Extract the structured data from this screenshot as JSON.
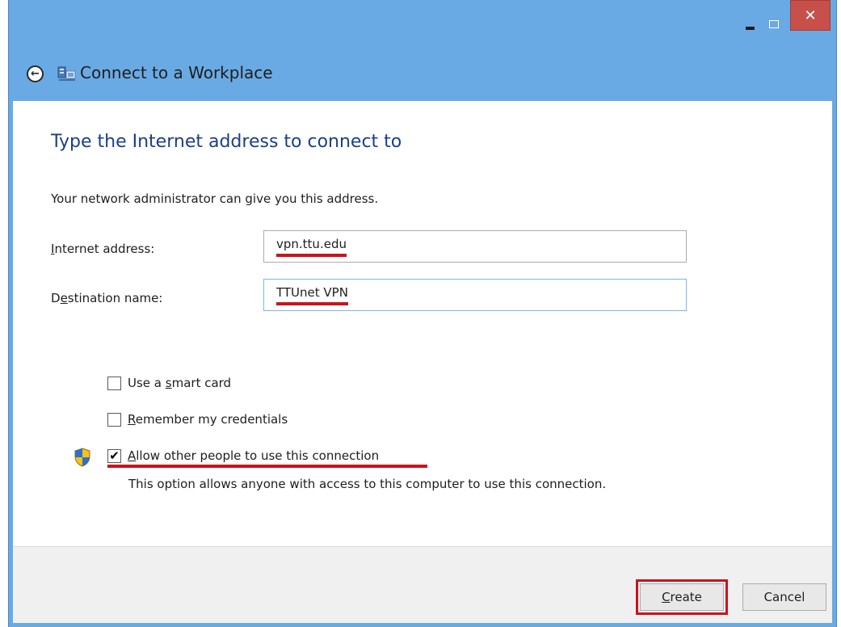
{
  "window": {
    "title": "Connect to a Workplace",
    "close_glyph": "✕",
    "accent_color": "#6aaae4"
  },
  "icons": {
    "back": "back-arrow-icon",
    "app": "network-workplace-icon",
    "shield": "uac-shield-icon"
  },
  "page": {
    "heading": "Type the Internet address to connect to",
    "subtext": "Your network administrator can give you this address."
  },
  "fields": {
    "internet_address": {
      "label_accel": "I",
      "label_rest": "nternet address:",
      "value": "vpn.ttu.edu"
    },
    "destination_name": {
      "label_before": "D",
      "label_accel": "e",
      "label_rest": "stination name:",
      "value": "TTUnet VPN"
    }
  },
  "options": {
    "smart_card": {
      "label_before": "Use a ",
      "label_accel": "s",
      "label_rest": "mart card",
      "checked": false
    },
    "remember": {
      "label_before": "",
      "label_accel": "R",
      "label_rest": "emember my credentials",
      "checked": false
    },
    "allow_others": {
      "label_before": "",
      "label_accel": "A",
      "label_rest": "llow other people to use this connection",
      "checked": true,
      "check_glyph": "✔",
      "description": "This option allows anyone with access to this computer to use this connection."
    }
  },
  "footer": {
    "create_accel": "C",
    "create_rest": "reate",
    "cancel": "Cancel"
  },
  "highlight_color": "#c8141e"
}
